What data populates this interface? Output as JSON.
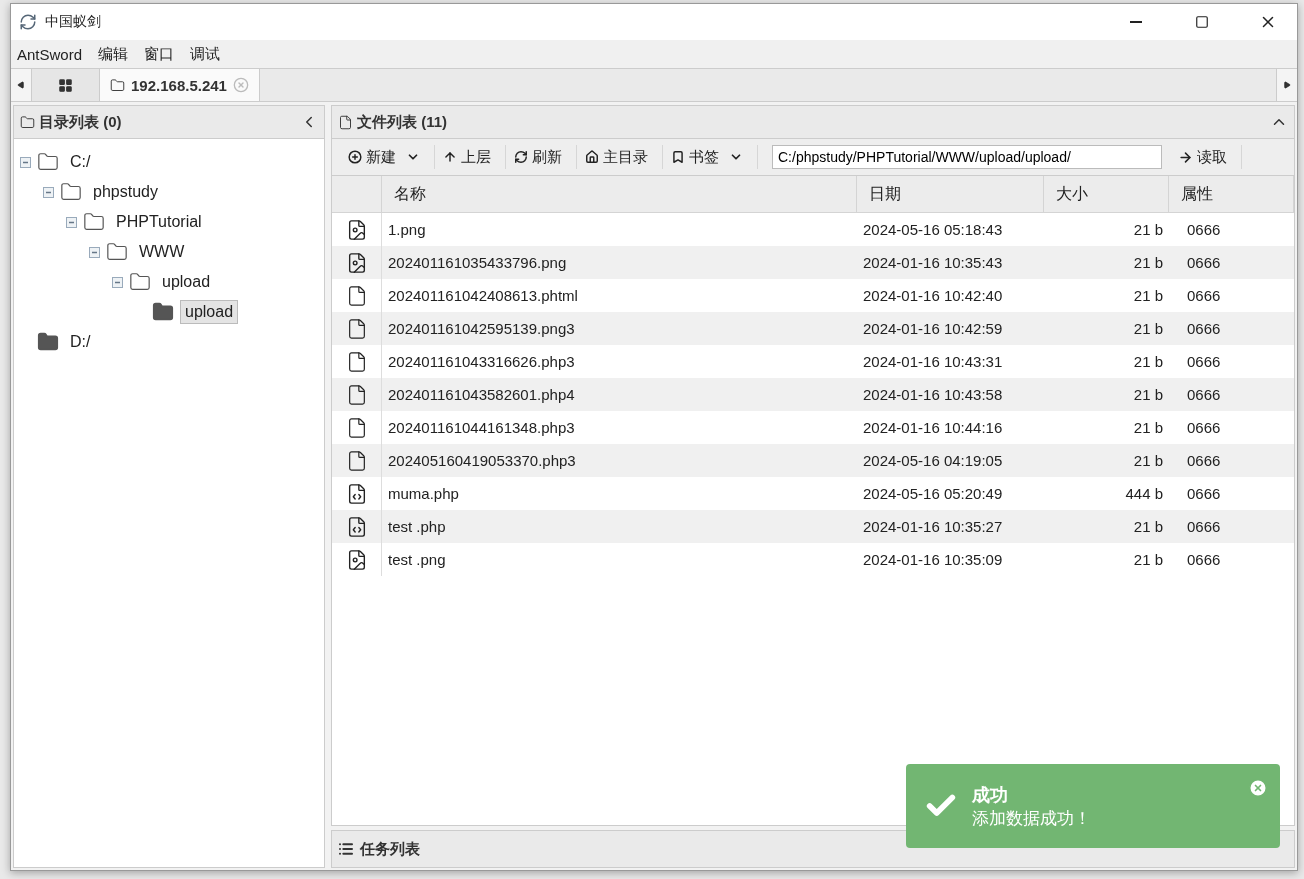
{
  "window": {
    "title": "中国蚁剑"
  },
  "menu": [
    "AntSword",
    "编辑",
    "窗口",
    "调试"
  ],
  "tabs": [
    {
      "kind": "home",
      "selected": false
    },
    {
      "kind": "folder",
      "label": "192.168.5.241",
      "selected": true
    }
  ],
  "tree_panel": {
    "title": "目录列表 (0)",
    "tree": [
      {
        "label": "C:/",
        "expanded": true,
        "selected": false,
        "children": [
          {
            "label": "phpstudy",
            "expanded": true,
            "selected": false,
            "children": [
              {
                "label": "PHPTutorial",
                "expanded": true,
                "selected": false,
                "children": [
                  {
                    "label": "WWW",
                    "expanded": true,
                    "selected": false,
                    "children": [
                      {
                        "label": "upload",
                        "expanded": true,
                        "selected": false,
                        "children": [
                          {
                            "label": "upload",
                            "expanded": false,
                            "selected": true
                          }
                        ]
                      }
                    ]
                  }
                ]
              }
            ]
          }
        ]
      },
      {
        "label": "D:/",
        "expanded": false,
        "selected": false
      }
    ]
  },
  "file_panel": {
    "title": "文件列表 (11)",
    "toolbar": [
      {
        "label": "新建",
        "dropdown": true
      },
      {
        "label": "上层",
        "dropdown": false
      },
      {
        "label": "刷新",
        "dropdown": false
      },
      {
        "label": "主目录",
        "dropdown": false
      },
      {
        "label": "书签",
        "dropdown": true
      }
    ],
    "path": "C:/phpstudy/PHPTutorial/WWW/upload/upload/",
    "read_button": "读取",
    "columns": [
      "名称",
      "日期",
      "大小",
      "属性"
    ],
    "rows": [
      {
        "kind": "image",
        "name": "1.png",
        "date": "2024-05-16 05:18:43",
        "size": "21 b",
        "attr": "0666"
      },
      {
        "kind": "image",
        "name": "202401161035433796.png",
        "date": "2024-01-16 10:35:43",
        "size": "21 b",
        "attr": "0666"
      },
      {
        "kind": "file",
        "name": "202401161042408613.phtml",
        "date": "2024-01-16 10:42:40",
        "size": "21 b",
        "attr": "0666"
      },
      {
        "kind": "file",
        "name": "202401161042595139.png3",
        "date": "2024-01-16 10:42:59",
        "size": "21 b",
        "attr": "0666"
      },
      {
        "kind": "file",
        "name": "202401161043316626.php3",
        "date": "2024-01-16 10:43:31",
        "size": "21 b",
        "attr": "0666"
      },
      {
        "kind": "file",
        "name": "202401161043582601.php4",
        "date": "2024-01-16 10:43:58",
        "size": "21 b",
        "attr": "0666"
      },
      {
        "kind": "file",
        "name": "202401161044161348.php3",
        "date": "2024-01-16 10:44:16",
        "size": "21 b",
        "attr": "0666"
      },
      {
        "kind": "file",
        "name": "202405160419053370.php3",
        "date": "2024-05-16 04:19:05",
        "size": "21 b",
        "attr": "0666"
      },
      {
        "kind": "code",
        "name": "muma.php",
        "date": "2024-05-16 05:20:49",
        "size": "444 b",
        "attr": "0666"
      },
      {
        "kind": "code",
        "name": "test .php",
        "date": "2024-01-16 10:35:27",
        "size": "21 b",
        "attr": "0666"
      },
      {
        "kind": "image",
        "name": "test .png",
        "date": "2024-01-16 10:35:09",
        "size": "21 b",
        "attr": "0666"
      }
    ]
  },
  "task_panel": {
    "title": "任务列表"
  },
  "toast": {
    "title": "成功",
    "message": "添加数据成功！"
  }
}
